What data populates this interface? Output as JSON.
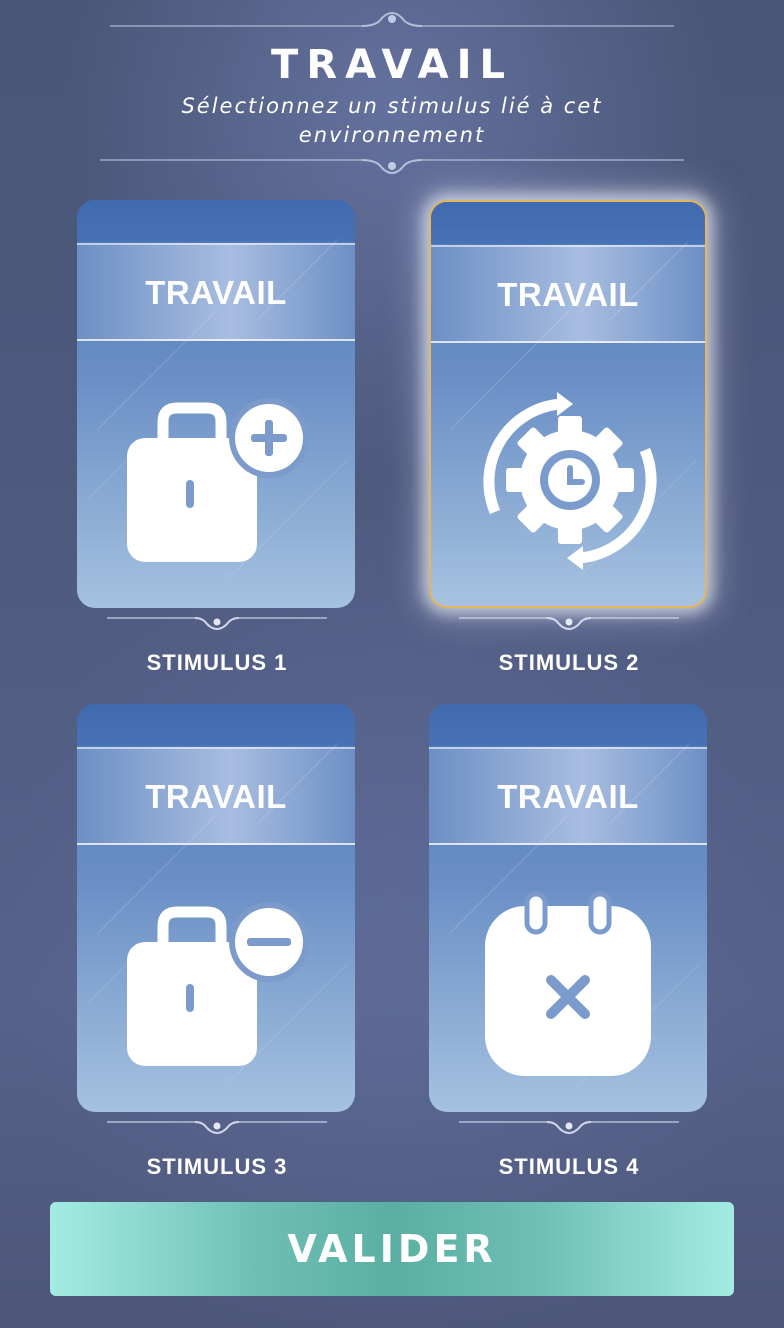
{
  "header": {
    "title": "TRAVAIL",
    "subtitle": "Sélectionnez un stimulus lié à cet environnement"
  },
  "cards": [
    {
      "category": "TRAVAIL",
      "label": "STIMULUS 1",
      "icon": "briefcase-plus-icon",
      "selected": false
    },
    {
      "category": "TRAVAIL",
      "label": "STIMULUS 2",
      "icon": "gear-clock-cycle-icon",
      "selected": true
    },
    {
      "category": "TRAVAIL",
      "label": "STIMULUS 3",
      "icon": "briefcase-minus-icon",
      "selected": false
    },
    {
      "category": "TRAVAIL",
      "label": "STIMULUS 4",
      "icon": "calendar-cancel-icon",
      "selected": false
    }
  ],
  "actions": {
    "validate_label": "VALIDER"
  },
  "colors": {
    "selected_border": "#e7b65a",
    "validate_button": "#6fc0b4",
    "card_blue": "#4d78b8"
  }
}
